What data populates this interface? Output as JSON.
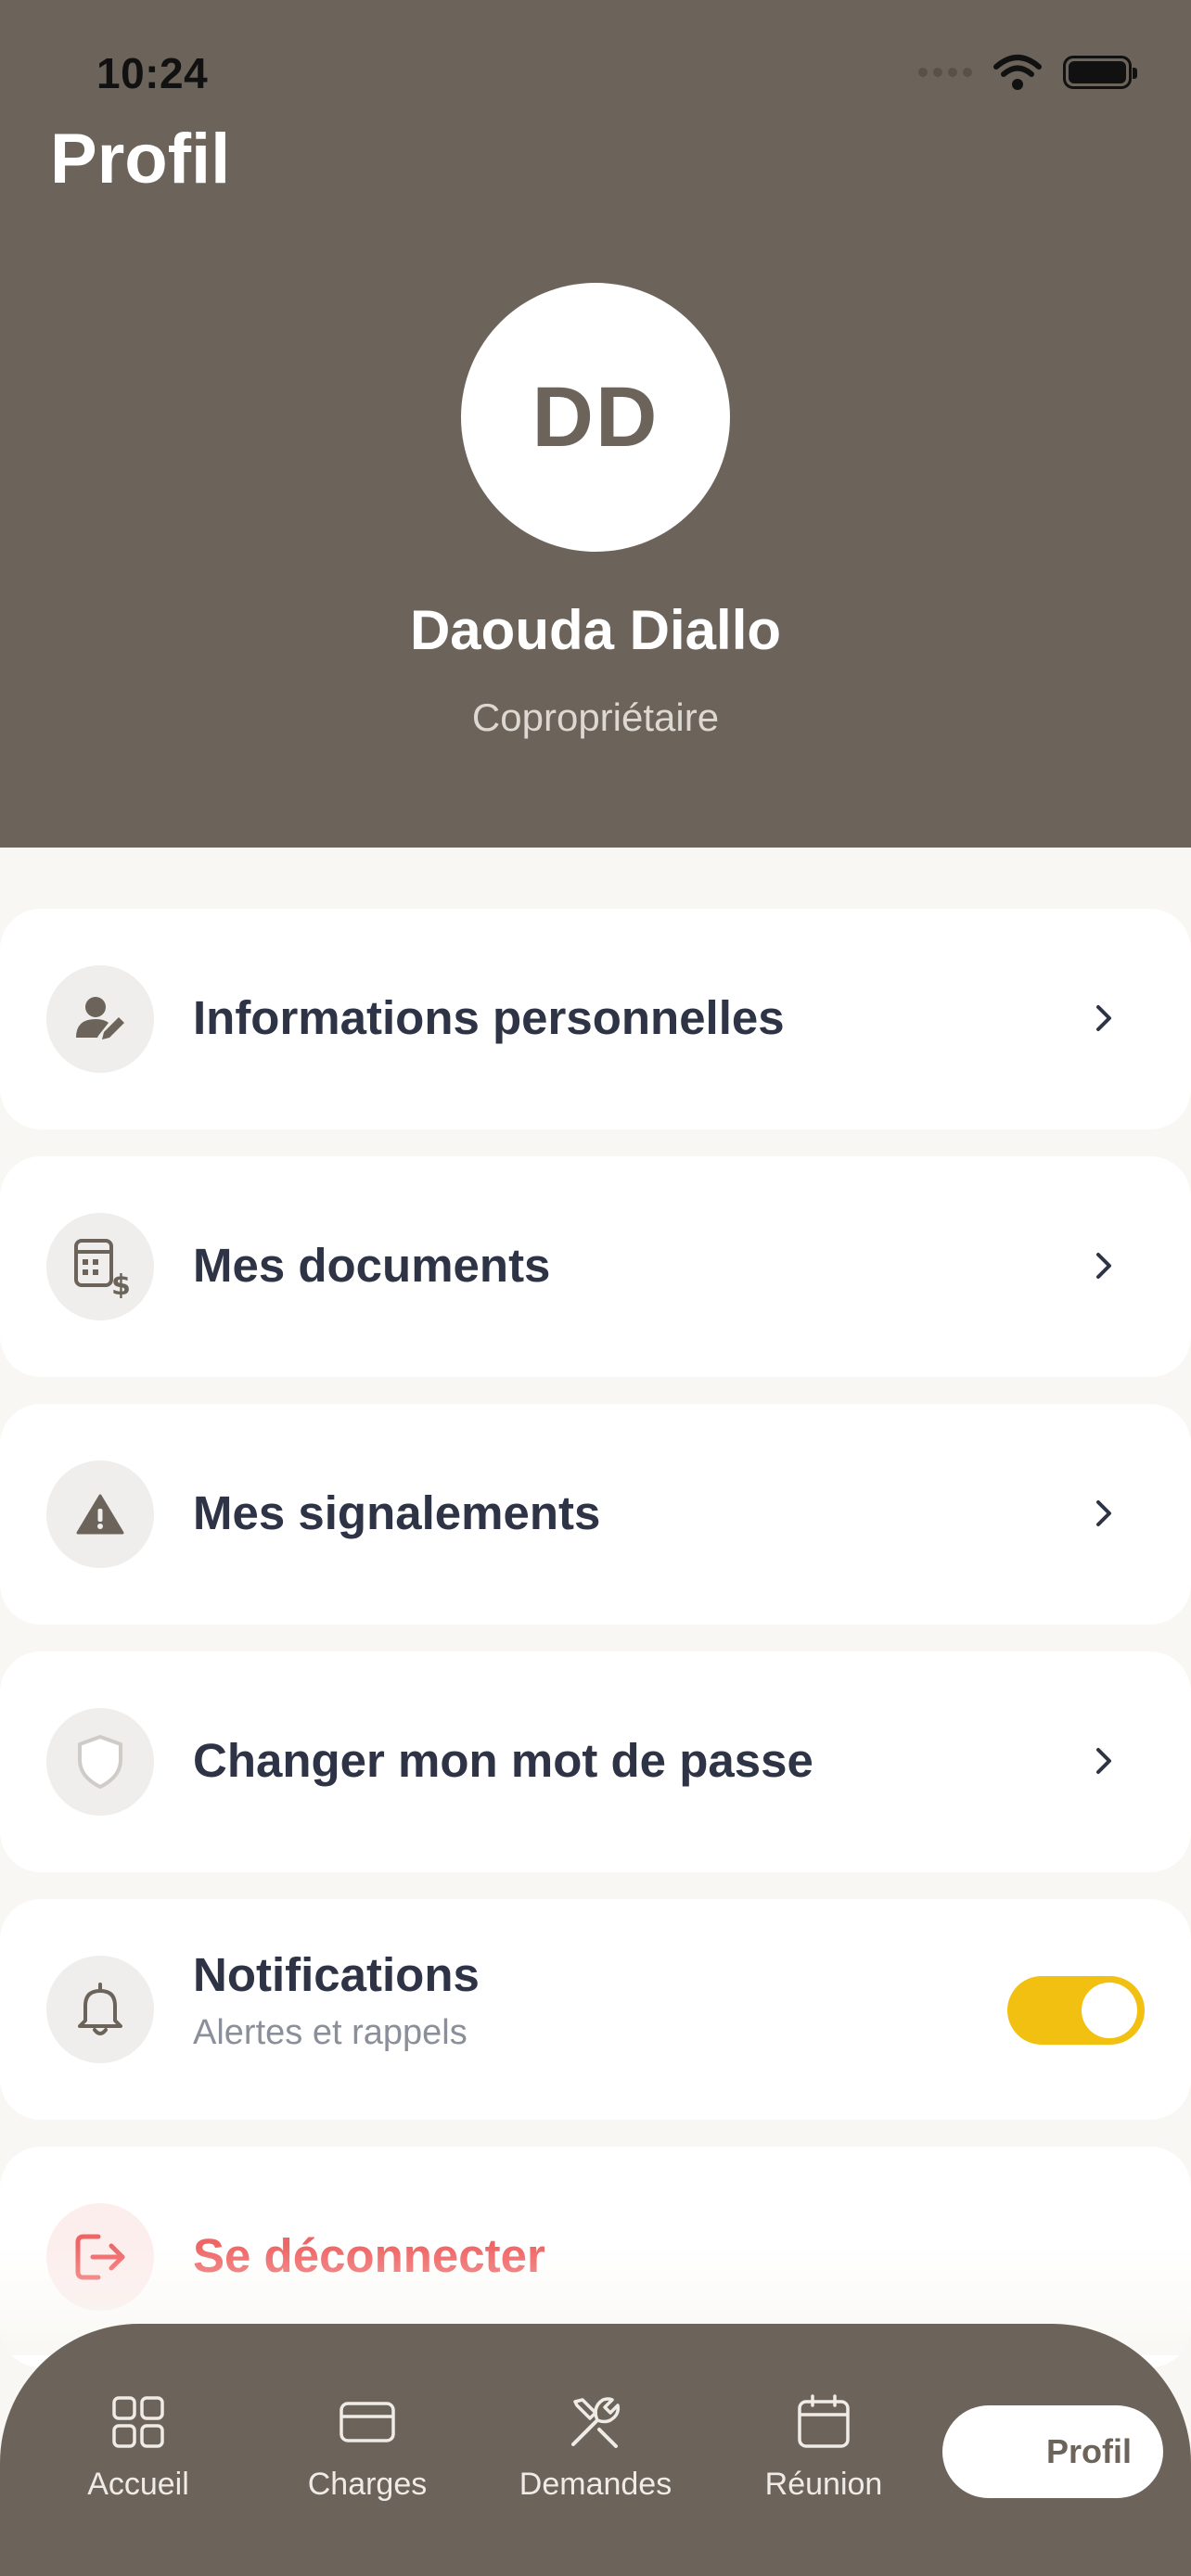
{
  "status_bar": {
    "time": "10:24"
  },
  "header": {
    "title": "Profil",
    "avatar_initials": "DD",
    "user_name": "Daouda Diallo",
    "user_role": "Copropriétaire"
  },
  "menu": {
    "items": [
      {
        "label": "Informations personnelles",
        "icon": "user-edit-icon"
      },
      {
        "label": "Mes documents",
        "icon": "invoice-icon"
      },
      {
        "label": "Mes signalements",
        "icon": "warning-icon"
      },
      {
        "label": "Changer mon mot de passe",
        "icon": "shield-icon"
      }
    ],
    "notifications": {
      "title": "Notifications",
      "subtitle": "Alertes et rappels",
      "enabled": true
    },
    "logout": {
      "label": "Se déconnecter",
      "icon": "logout-icon"
    }
  },
  "tabbar": {
    "tabs": [
      {
        "label": "Accueil",
        "icon": "grid-icon"
      },
      {
        "label": "Charges",
        "icon": "card-icon"
      },
      {
        "label": "Demandes",
        "icon": "tools-icon"
      },
      {
        "label": "Réunion",
        "icon": "calendar-icon"
      },
      {
        "label": "Profil",
        "icon": "profile-icon",
        "active": true
      }
    ]
  },
  "colors": {
    "brand": "#6c635a",
    "accent_toggle": "#f2c010",
    "danger": "#ef6464",
    "text_dark": "#2e3445"
  }
}
